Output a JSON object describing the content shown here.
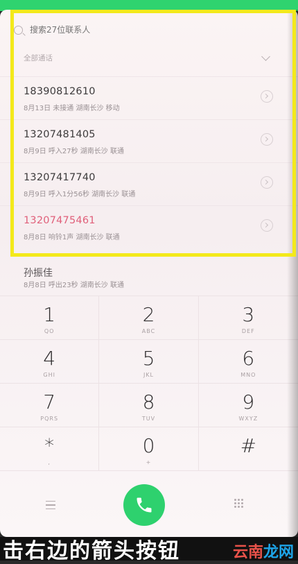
{
  "search": {
    "placeholder": "搜索27位联系人"
  },
  "section": {
    "title": "全部通话"
  },
  "calls": [
    {
      "number": "18390812610",
      "meta": "8月13日 未接通  湖南长沙 移动",
      "missed": false
    },
    {
      "number": "13207481405",
      "meta": "8月9日 呼入27秒  湖南长沙 联通",
      "missed": false
    },
    {
      "number": "13207417740",
      "meta": "8月9日 呼入1分56秒  湖南长沙 联通",
      "missed": false
    },
    {
      "number": "13207475461",
      "meta": "8月8日 响铃1声  湖南长沙 联通",
      "missed": true
    }
  ],
  "partial_row": {
    "title": "孙振佳",
    "meta": "8月8日 呼出23秒  湖南长沙 联通"
  },
  "keypad": [
    {
      "digit": "1",
      "letters": "QO"
    },
    {
      "digit": "2",
      "letters": "ABC"
    },
    {
      "digit": "3",
      "letters": "DEF"
    },
    {
      "digit": "4",
      "letters": "GHI"
    },
    {
      "digit": "5",
      "letters": "JKL"
    },
    {
      "digit": "6",
      "letters": "MNO"
    },
    {
      "digit": "7",
      "letters": "PQRS"
    },
    {
      "digit": "8",
      "letters": "TUV"
    },
    {
      "digit": "9",
      "letters": "WXYZ"
    },
    {
      "digit": "*",
      "letters": ","
    },
    {
      "digit": "0",
      "letters": "+"
    },
    {
      "digit": "#",
      "letters": ""
    }
  ],
  "caption": {
    "text": "击右边的箭头按钮"
  },
  "watermark": {
    "part1": "云南",
    "part2": "龙网"
  },
  "colors": {
    "call_green": "#2ed16e",
    "missed_red": "#e0607a",
    "highlight_yellow": "#f3e91b"
  }
}
